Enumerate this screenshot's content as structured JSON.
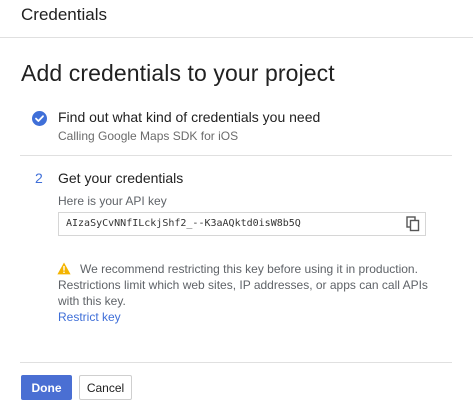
{
  "header": {
    "title": "Credentials"
  },
  "page": {
    "title": "Add credentials to your project"
  },
  "step1": {
    "title": "Find out what kind of credentials you need",
    "subtitle": "Calling Google Maps SDK for iOS",
    "status_icon": "check-circle-icon",
    "status_color": "#3f6fd8"
  },
  "step2": {
    "number": "2",
    "title": "Get your credentials",
    "api_key_label": "Here is your API key",
    "api_key_value": "AIzaSyCvNNfILckjShf2_--K3aAQktd0isW8b5Q",
    "copy_icon": "copy-icon"
  },
  "warning": {
    "icon": "warning-icon",
    "icon_color": "#f4b400",
    "text": "We recommend restricting this key before using it in production. Restrictions limit which web sites, IP addresses, or apps can call APIs with this key.",
    "link_label": "Restrict key"
  },
  "actions": {
    "done_label": "Done",
    "cancel_label": "Cancel",
    "primary_color": "#4a6fd3"
  }
}
